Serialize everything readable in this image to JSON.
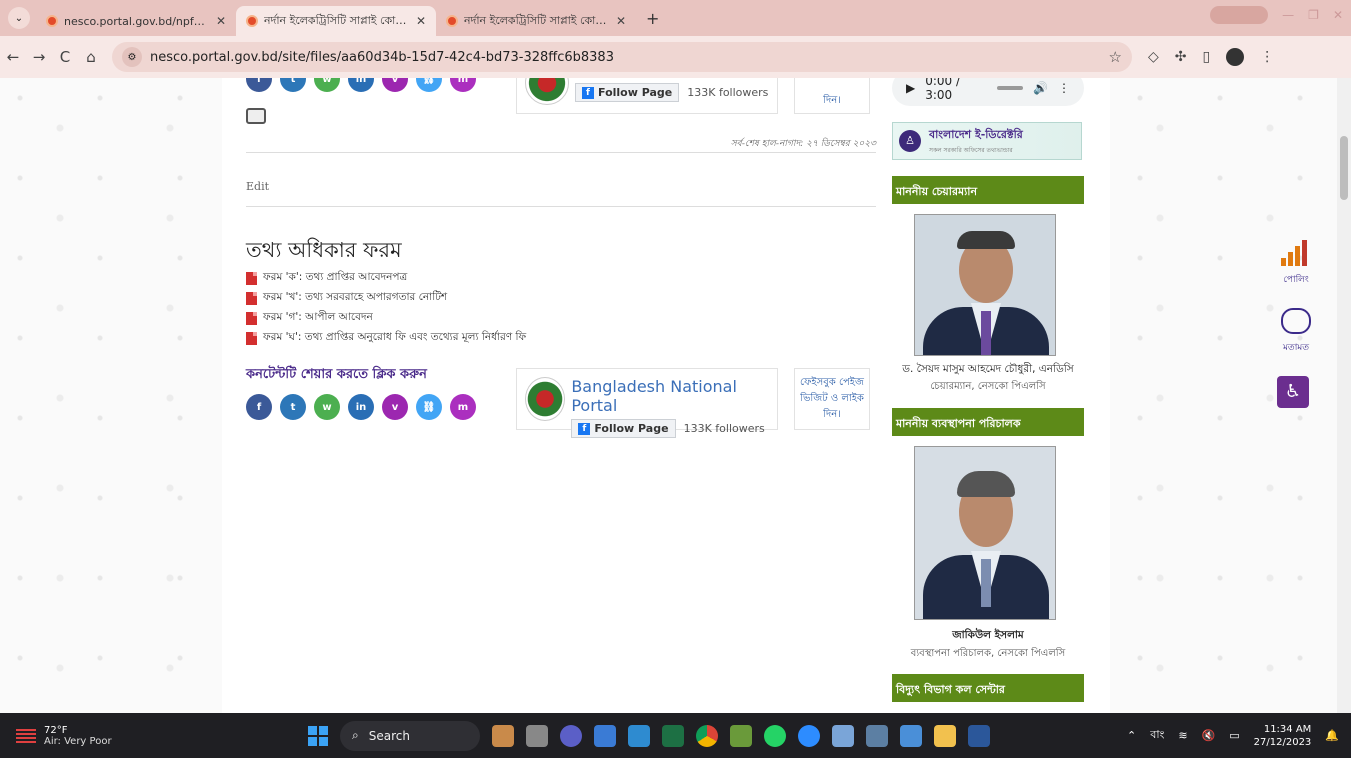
{
  "browser": {
    "tabs": [
      {
        "title": "nesco.portal.gov.bd/npfadmin/"
      },
      {
        "title": "নর্দান ইলেকট্রিসিটি সাপ্লাই কোম্পানি"
      },
      {
        "title": "নর্দান ইলেকট্রিসিটি সাপ্লাই কোম্পানি"
      }
    ],
    "new_tab": "+",
    "url": "nesco.portal.gov.bd/site/files/aa60d34b-15d7-42c4-bd73-328ffc6b8383",
    "nav": {
      "back": "←",
      "forward": "→",
      "reload": "C",
      "home": "⌂"
    }
  },
  "top_fb": {
    "follow_label": "Follow Page",
    "followers": "133K followers",
    "like_text": "দিন।"
  },
  "audio": {
    "time": "0:00 / 3:00"
  },
  "updated": "সর্ব-শেষ হাল-নাগাদ: ২৭ ডিসেম্বর ২০২৩",
  "edit": "Edit",
  "page_title": "তথ্য অধিকার ফরম",
  "files": [
    {
      "label": "ফরম 'ক': তথ্য প্রাপ্তির আবেদনপত্র"
    },
    {
      "label": "ফরম 'খ': তথ্য সরবরাহে অপারগতার নোটিশ"
    },
    {
      "label": "ফরম 'গ': আপীল আবেদন"
    },
    {
      "label": "ফরম 'ঘ': তথ্য প্রাপ্তির অনুরোধ ফি এবং তথ্যের মূল্য নির্ধারণ ফি"
    }
  ],
  "share_title": "কনটেন্টটি শেয়ার করতে ক্লিক করুন",
  "share_buttons": [
    {
      "icon": "facebook-icon",
      "glyph": "f",
      "color": "#3b5998"
    },
    {
      "icon": "twitter-icon",
      "glyph": "t",
      "color": "#2d77b8"
    },
    {
      "icon": "whatsapp-icon",
      "glyph": "w",
      "color": "#4caf50"
    },
    {
      "icon": "linkedin-icon",
      "glyph": "in",
      "color": "#2a6eb5"
    },
    {
      "icon": "viber-icon",
      "glyph": "v",
      "color": "#9c27b0"
    },
    {
      "icon": "link-icon",
      "glyph": "⛓",
      "color": "#42a5f5"
    },
    {
      "icon": "messenger-icon",
      "glyph": "m",
      "color": "#ab2fbf"
    }
  ],
  "fb_box": {
    "name": "Bangladesh National Portal",
    "follow_label": "Follow Page",
    "followers": "133K followers",
    "like_text": "ফেইসবুক পেইজ ভিজিট ও লাইক দিন।"
  },
  "sidebar": {
    "edir_title": "বাংলাদেশ ই-ডিরেক্টরি",
    "edir_sub": "সকল সরকারি অফিসের তথ্যভান্ডার",
    "chairman_heading": "মাননীয় চেয়ারম্যান",
    "chairman_name": "ড. সৈয়দ মাসুম আহমেদ চৌধুরী, এনডিসি",
    "chairman_role": "চেয়ারম্যান, নেসকো পিএলসি",
    "md_heading": "মাননীয় ব্যবস্থাপনা পরিচালক",
    "md_name": "জাকিউল ইসলাম",
    "md_role": "ব্যবস্থাপনা পরিচালক, নেসকো পিএলসি",
    "callcenter_heading": "বিদ্যুৎ বিভাগ কল সেন্টার"
  },
  "float": {
    "poll_label": "পোলিং",
    "feedback_label": "মতামত"
  },
  "taskbar": {
    "temp": "72°F",
    "air": "Air: Very Poor",
    "search": "Search",
    "lang": "বাং",
    "time": "11:34 AM",
    "date": "27/12/2023"
  },
  "colors": {
    "green_bar": "#5d8a18",
    "accent_purple": "#4a2a8a",
    "tabbar": "#e8c4c0"
  }
}
